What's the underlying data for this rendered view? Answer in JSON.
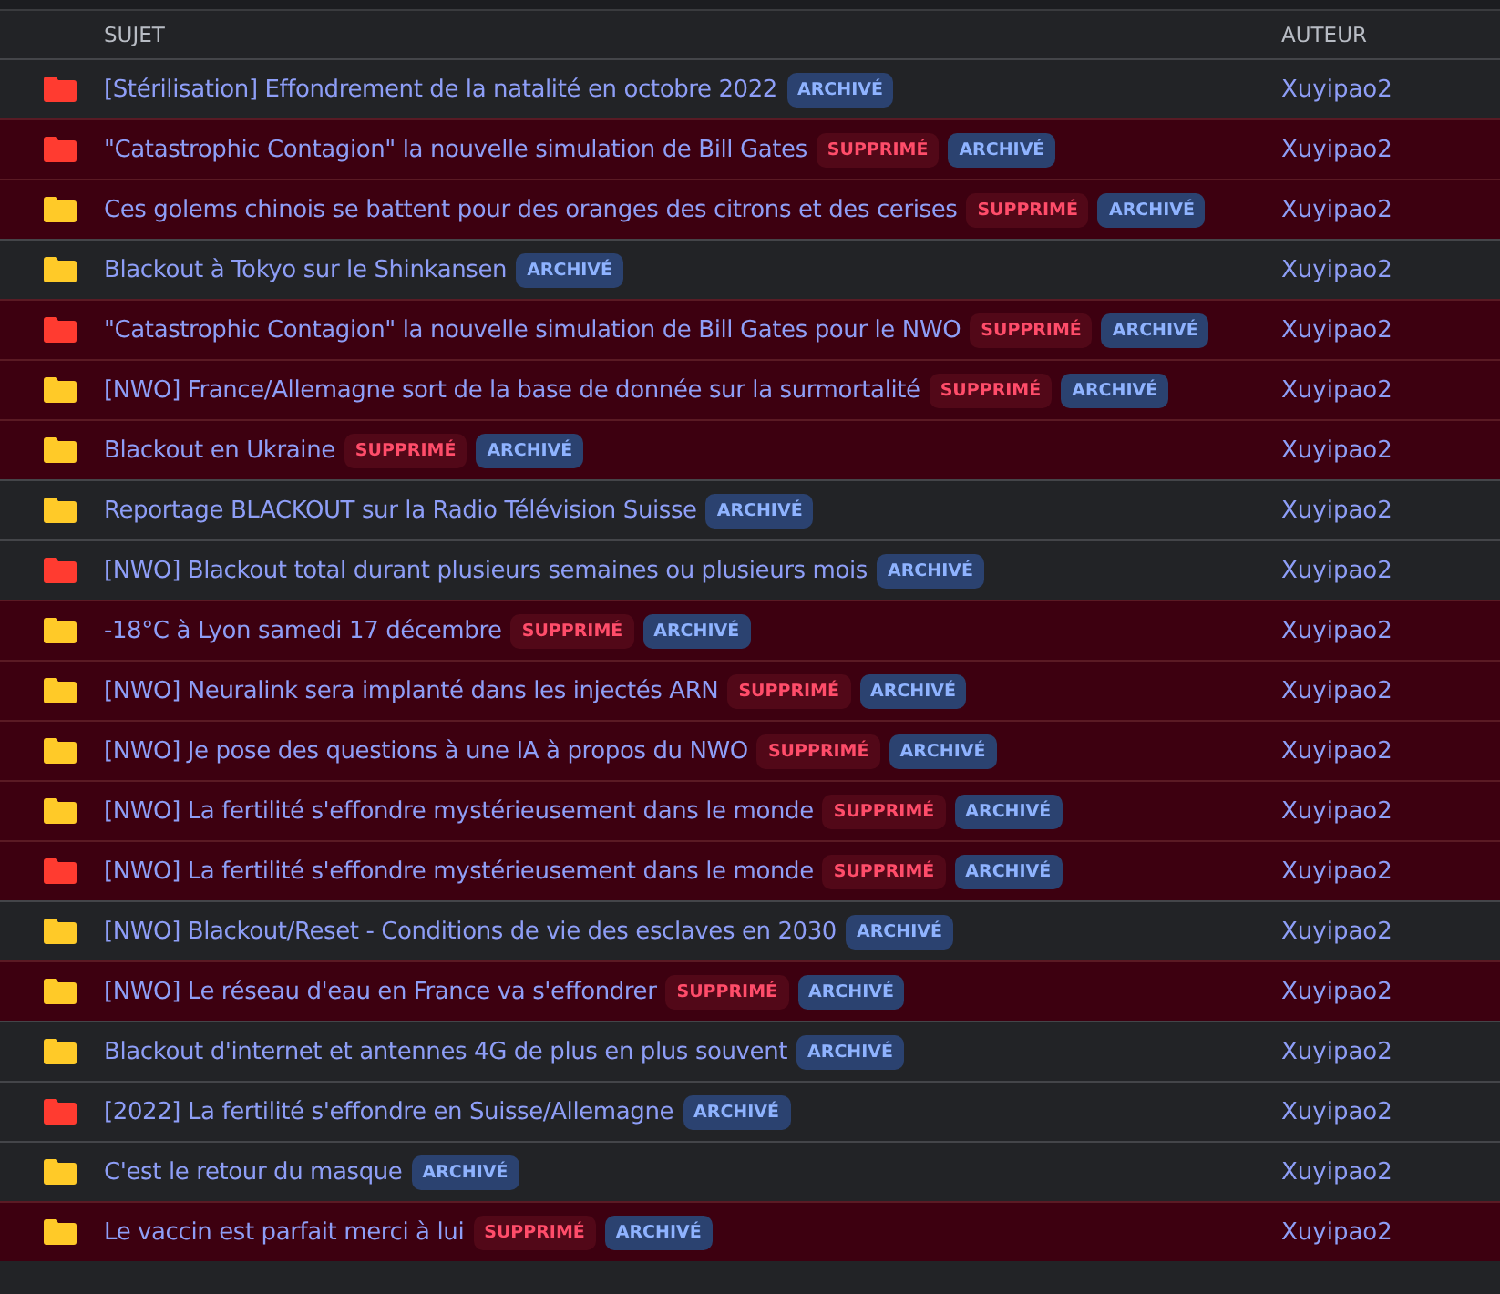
{
  "columns": [
    "SUJET",
    "AUTEUR"
  ],
  "rows": [
    {
      "color": "#ff3b30",
      "subject": "[Stérilisation] Effondrement de la natalité en octobre 2022",
      "deleted": false,
      "badges": [
        {
          "kind": "archived",
          "label": "ARCHIVÉ"
        }
      ],
      "author": "Xuyipao2"
    },
    {
      "color": "#ff3b30",
      "subject": "\"Catastrophic Contagion\" la nouvelle simulation de Bill Gates",
      "deleted": true,
      "badges": [
        {
          "kind": "deleted",
          "label": "SUPPRIMÉ"
        },
        {
          "kind": "archived",
          "label": "ARCHIVÉ"
        }
      ],
      "author": "Xuyipao2"
    },
    {
      "color": "#ffca28",
      "subject": "Ces golems chinois se battent pour des oranges des citrons et des cerises",
      "deleted": true,
      "badges": [
        {
          "kind": "deleted",
          "label": "SUPPRIMÉ"
        },
        {
          "kind": "archived",
          "label": "ARCHIVÉ"
        }
      ],
      "author": "Xuyipao2"
    },
    {
      "color": "#ffca28",
      "subject": "Blackout à Tokyo sur le Shinkansen",
      "deleted": false,
      "badges": [
        {
          "kind": "archived",
          "label": "ARCHIVÉ"
        }
      ],
      "author": "Xuyipao2"
    },
    {
      "color": "#ff3b30",
      "subject": "\"Catastrophic Contagion\" la nouvelle simulation de Bill Gates pour le NWO",
      "deleted": true,
      "badges": [
        {
          "kind": "deleted",
          "label": "SUPPRIMÉ"
        },
        {
          "kind": "archived",
          "label": "ARCHIVÉ"
        }
      ],
      "author": "Xuyipao2"
    },
    {
      "color": "#ffca28",
      "subject": "[NWO] France/Allemagne sort de la base de donnée sur la surmortalité",
      "deleted": true,
      "badges": [
        {
          "kind": "deleted",
          "label": "SUPPRIMÉ"
        },
        {
          "kind": "archived",
          "label": "ARCHIVÉ"
        }
      ],
      "author": "Xuyipao2"
    },
    {
      "color": "#ffca28",
      "subject": "Blackout en Ukraine",
      "deleted": true,
      "badges": [
        {
          "kind": "deleted",
          "label": "SUPPRIMÉ"
        },
        {
          "kind": "archived",
          "label": "ARCHIVÉ"
        }
      ],
      "author": "Xuyipao2"
    },
    {
      "color": "#ffca28",
      "subject": "Reportage BLACKOUT sur la Radio Télévision Suisse",
      "deleted": false,
      "badges": [
        {
          "kind": "archived",
          "label": "ARCHIVÉ"
        }
      ],
      "author": "Xuyipao2"
    },
    {
      "color": "#ff3b30",
      "subject": "[NWO] Blackout total durant plusieurs semaines ou plusieurs mois",
      "deleted": false,
      "badges": [
        {
          "kind": "archived",
          "label": "ARCHIVÉ"
        }
      ],
      "author": "Xuyipao2"
    },
    {
      "color": "#ffca28",
      "subject": "-18°C à Lyon samedi 17 décembre",
      "deleted": true,
      "badges": [
        {
          "kind": "deleted",
          "label": "SUPPRIMÉ"
        },
        {
          "kind": "archived",
          "label": "ARCHIVÉ"
        }
      ],
      "author": "Xuyipao2"
    },
    {
      "color": "#ffca28",
      "subject": "[NWO] Neuralink sera implanté dans les injectés ARN",
      "deleted": true,
      "badges": [
        {
          "kind": "deleted",
          "label": "SUPPRIMÉ"
        },
        {
          "kind": "archived",
          "label": "ARCHIVÉ"
        }
      ],
      "author": "Xuyipao2"
    },
    {
      "color": "#ffca28",
      "subject": "[NWO] Je pose des questions à une IA à propos du NWO",
      "deleted": true,
      "badges": [
        {
          "kind": "deleted",
          "label": "SUPPRIMÉ"
        },
        {
          "kind": "archived",
          "label": "ARCHIVÉ"
        }
      ],
      "author": "Xuyipao2"
    },
    {
      "color": "#ffca28",
      "subject": "[NWO] La fertilité s'effondre mystérieusement dans le monde",
      "deleted": true,
      "badges": [
        {
          "kind": "deleted",
          "label": "SUPPRIMÉ"
        },
        {
          "kind": "archived",
          "label": "ARCHIVÉ"
        }
      ],
      "author": "Xuyipao2"
    },
    {
      "color": "#ff3b30",
      "subject": "[NWO] La fertilité s'effondre mystérieusement dans le monde",
      "deleted": true,
      "badges": [
        {
          "kind": "deleted",
          "label": "SUPPRIMÉ"
        },
        {
          "kind": "archived",
          "label": "ARCHIVÉ"
        }
      ],
      "author": "Xuyipao2"
    },
    {
      "color": "#ffca28",
      "subject": "[NWO] Blackout/Reset - Conditions de vie des esclaves en 2030",
      "deleted": false,
      "badges": [
        {
          "kind": "archived",
          "label": "ARCHIVÉ"
        }
      ],
      "author": "Xuyipao2"
    },
    {
      "color": "#ffca28",
      "subject": "[NWO] Le réseau d'eau en France va s'effondrer",
      "deleted": true,
      "badges": [
        {
          "kind": "deleted",
          "label": "SUPPRIMÉ"
        },
        {
          "kind": "archived",
          "label": "ARCHIVÉ"
        }
      ],
      "author": "Xuyipao2"
    },
    {
      "color": "#ffca28",
      "subject": "Blackout d'internet et antennes 4G de plus en plus souvent",
      "deleted": false,
      "badges": [
        {
          "kind": "archived",
          "label": "ARCHIVÉ"
        }
      ],
      "author": "Xuyipao2"
    },
    {
      "color": "#ff3b30",
      "subject": "[2022] La fertilité s'effondre en Suisse/Allemagne",
      "deleted": false,
      "badges": [
        {
          "kind": "archived",
          "label": "ARCHIVÉ"
        }
      ],
      "author": "Xuyipao2"
    },
    {
      "color": "#ffca28",
      "subject": "C'est le retour du masque",
      "deleted": false,
      "badges": [
        {
          "kind": "archived",
          "label": "ARCHIVÉ"
        }
      ],
      "author": "Xuyipao2"
    },
    {
      "color": "#ffca28",
      "subject": "Le vaccin est parfait merci à lui",
      "deleted": true,
      "badges": [
        {
          "kind": "deleted",
          "label": "SUPPRIMÉ"
        },
        {
          "kind": "archived",
          "label": "ARCHIVÉ"
        }
      ],
      "author": "Xuyipao2"
    }
  ]
}
